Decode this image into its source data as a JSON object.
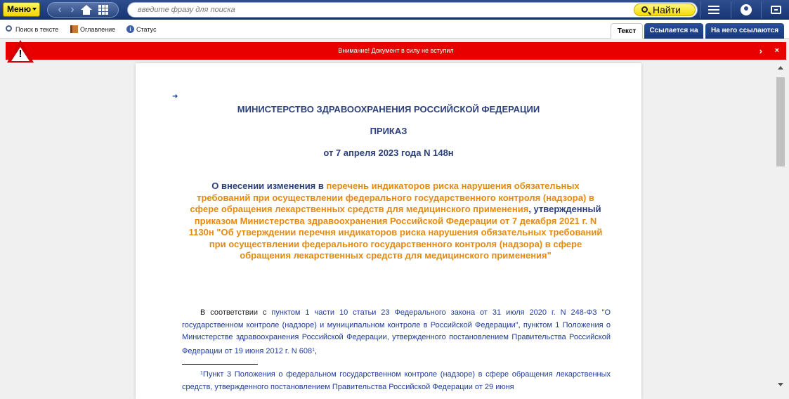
{
  "topbar": {
    "menu_label": "Меню",
    "search_placeholder": "введите фразу для поиска",
    "find_label": "Найти"
  },
  "toolbar": {
    "search_in_text": "Поиск в тексте",
    "contents": "Оглавление",
    "status": "Статус",
    "tabs": [
      {
        "label": "Текст",
        "active": true
      },
      {
        "label": "Ссылается на",
        "active": false
      },
      {
        "label": "На него ссылаются",
        "active": false
      }
    ]
  },
  "warning": {
    "text": "Внимание! Документ в силу не вступил",
    "expand_glyph": "›",
    "close_glyph": "×"
  },
  "document": {
    "ministry": "МИНИСТЕРСТВО ЗДРАВООХРАНЕНИЯ РОССИЙСКОЙ ФЕДЕРАЦИИ",
    "doc_type": "ПРИКАЗ",
    "doc_date": "от 7 апреля 2023 года N 148н",
    "title_part1": "О внесении изменения в ",
    "title_link1": "перечень индикаторов риска нарушения обязательных требований при осуществлении федерального государственного контроля (надзора) в сфере обращения лекарственных средств для медицинского применения",
    "title_part2": ", утвержденный ",
    "title_link2": "приказом Министерства здравоохранения Российской Федерации от 7 декабря 2021 г. N 1130н \"Об утверждении перечня индикаторов риска нарушения обязательных требований при осуществлении федерального государственного контроля (надзора) в сфере обращения лекарственных средств для медицинского применения\"",
    "body_part1": "В соответствии с ",
    "body_link1": "пунктом 1 части 10 статьи 23 Федерального закона от 31 июля 2020 г. N 248-ФЗ \"О государственном контроле (надзоре) и муниципальном контроле в Российской Федерации\"",
    "body_part2": ", ",
    "body_link2": "пунктом 1 Положения о Министерстве здравоохранения Российской Федерации, утвержденного постановлением Правительства Российской Федерации от 19 июня 2012 г. N 608",
    "body_sup": "1",
    "body_end": ",",
    "footnote_sup": "1",
    "footnote_text": "Пункт 3 Положения о федеральном государственном контроле (надзоре) в сфере обращения лекарственных средств, утвержденного постановлением Правительства Российской Федерации от 29 июня"
  }
}
